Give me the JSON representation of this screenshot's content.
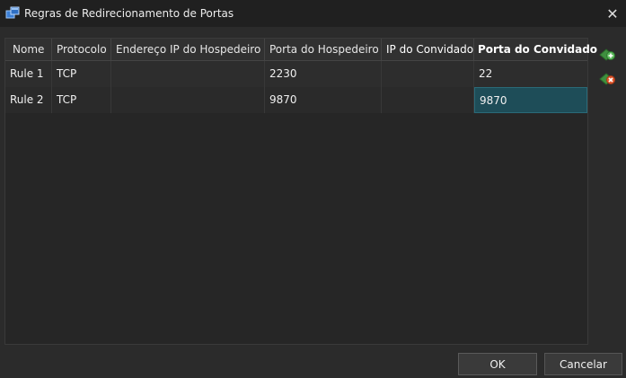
{
  "window": {
    "title": "Regras de Redirecionamento de Portas",
    "close_label": "✕"
  },
  "table": {
    "columns": [
      "Nome",
      "Protocolo",
      "Endereço IP do Hospedeiro",
      "Porta do Hospedeiro",
      "IP do Convidado",
      "Porta do Convidado"
    ],
    "sorted_column": "Porta do Convidado",
    "rows": [
      {
        "name": "Rule 1",
        "protocol": "TCP",
        "host_ip": "",
        "host_port": "2230",
        "guest_ip": "",
        "guest_port": "22"
      },
      {
        "name": "Rule 2",
        "protocol": "TCP",
        "host_ip": "",
        "host_port": "9870",
        "guest_ip": "",
        "guest_port": "9870"
      }
    ],
    "selected_cell": "Rule 2 / Porta do Convidado"
  },
  "side_actions": {
    "add_icon": "add-rule-icon",
    "remove_icon": "remove-rule-icon"
  },
  "footer": {
    "ok_label": "OK",
    "cancel_label": "Cancelar"
  },
  "colors": {
    "add": "#5cb85c",
    "remove": "#e0552b",
    "selection": "#1e4d58"
  }
}
